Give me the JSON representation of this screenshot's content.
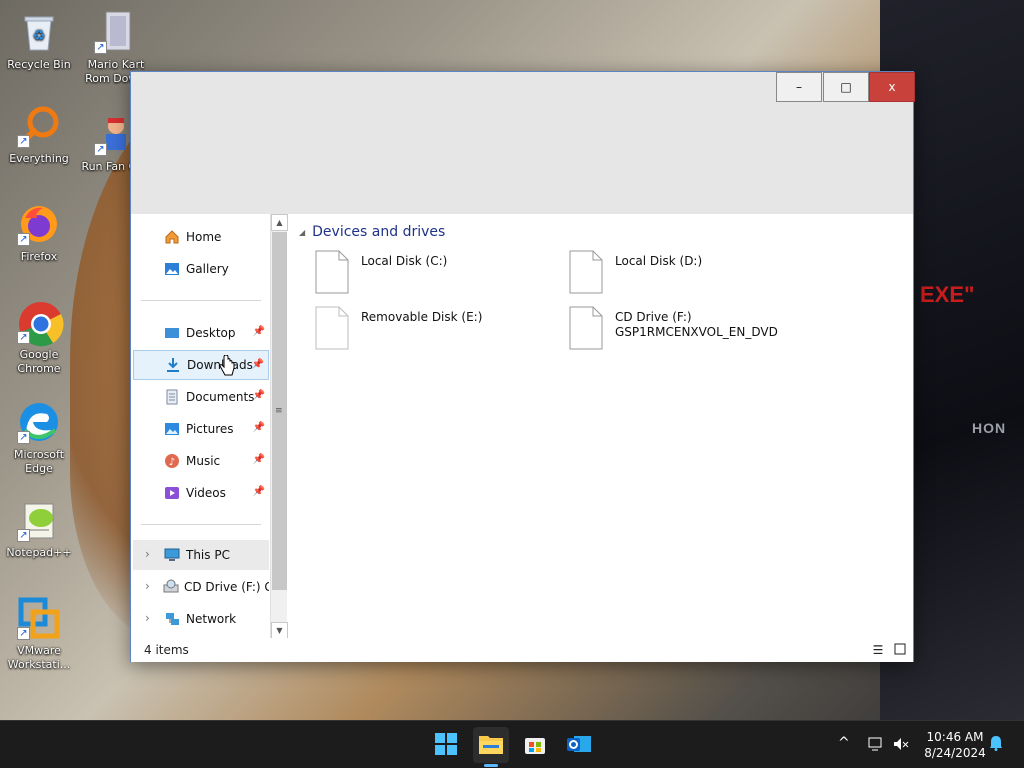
{
  "desktop": {
    "icons": [
      {
        "label": "Recycle Bin"
      },
      {
        "label": "Mario Kart Rom Dow..."
      },
      {
        "label": "Everything"
      },
      {
        "label": "Run Fan Guy"
      },
      {
        "label": "Firefox"
      },
      {
        "label": "Google Chrome"
      },
      {
        "label": "Microsoft Edge"
      },
      {
        "label": "Notepad++"
      },
      {
        "label": "VMware Workstati..."
      }
    ],
    "wallpaper_text": {
      "exe": "EXE\"",
      "brand": "HON"
    }
  },
  "window": {
    "controls": {
      "minimize": "–",
      "maximize": "□",
      "close": "x"
    }
  },
  "nav": {
    "items": [
      {
        "label": "Home",
        "icon": "home-icon"
      },
      {
        "label": "Gallery",
        "icon": "gallery-icon"
      },
      {
        "label": "Desktop",
        "icon": "desktop-folder-icon"
      },
      {
        "label": "Downloads",
        "icon": "download-icon"
      },
      {
        "label": "Documents",
        "icon": "documents-icon"
      },
      {
        "label": "Pictures",
        "icon": "pictures-icon"
      },
      {
        "label": "Music",
        "icon": "music-icon"
      },
      {
        "label": "Videos",
        "icon": "videos-icon"
      },
      {
        "label": "This PC",
        "icon": "computer-icon"
      },
      {
        "label": "CD Drive (F:) GS",
        "icon": "cd-drive-icon"
      },
      {
        "label": "Network",
        "icon": "network-icon"
      }
    ]
  },
  "content": {
    "group_title": "Devices and drives",
    "drives": [
      {
        "line1": "Local Disk (C:)",
        "line2": ""
      },
      {
        "line1": "Local Disk (D:)",
        "line2": ""
      },
      {
        "line1": "Removable Disk (E:)",
        "line2": ""
      },
      {
        "line1": "CD Drive (F:)",
        "line2": "GSP1RMCENXVOL_EN_DVD"
      }
    ]
  },
  "status": {
    "item_count": "4 items"
  },
  "taskbar": {
    "clock_time": "10:46 AM",
    "clock_date": "8/24/2024"
  },
  "colors": {
    "accent": "#0078d4",
    "close": "#c8413a",
    "group_title": "#1e3287"
  }
}
